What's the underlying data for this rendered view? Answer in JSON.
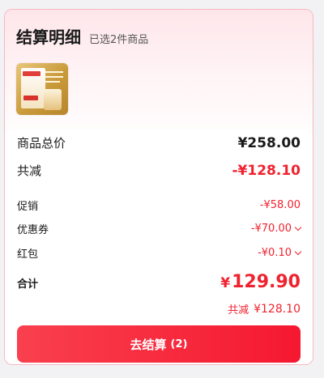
{
  "header": {
    "title": "结算明细",
    "subtitle": "已选2件商品"
  },
  "product": {
    "thumb_icon": "milk-powder-product-image"
  },
  "summary": {
    "total_label": "商品总价",
    "total_value": "¥258.00",
    "reduce_label": "共减",
    "reduce_value": "-¥128.10",
    "promo_label": "促销",
    "promo_value": "-¥58.00",
    "coupon_label": "优惠券",
    "coupon_value": "-¥70.00",
    "redpack_label": "红包",
    "redpack_value": "-¥0.10",
    "sum_label": "合计",
    "sum_currency": "¥",
    "sum_value": "129.90",
    "save_label": "共减",
    "save_value": "¥128.10"
  },
  "checkout": {
    "label": "去结算",
    "count": "(2)"
  },
  "colors": {
    "accent": "#f0222e",
    "button": "#f51830"
  }
}
